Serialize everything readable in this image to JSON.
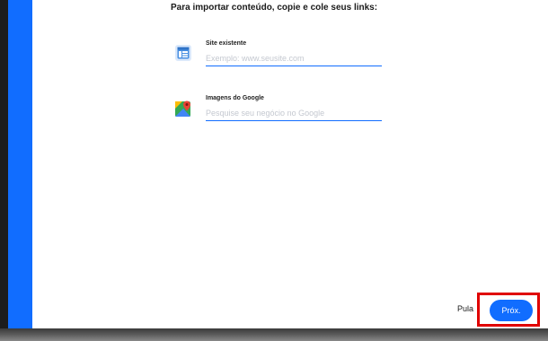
{
  "heading": "Para importar conteúdo, copie e cole seus links:",
  "fields": [
    {
      "label": "Site existente",
      "placeholder": "Exemplo: www.seusite.com",
      "value": "",
      "icon": "website-icon"
    },
    {
      "label": "Imagens do Google",
      "placeholder": "Pesquise seu negócio no Google",
      "value": "",
      "icon": "google-maps-icon"
    }
  ],
  "footer": {
    "skip_label": "Pula",
    "next_label": "Próx."
  },
  "colors": {
    "accent": "#116dff",
    "highlight": "#e00000"
  }
}
